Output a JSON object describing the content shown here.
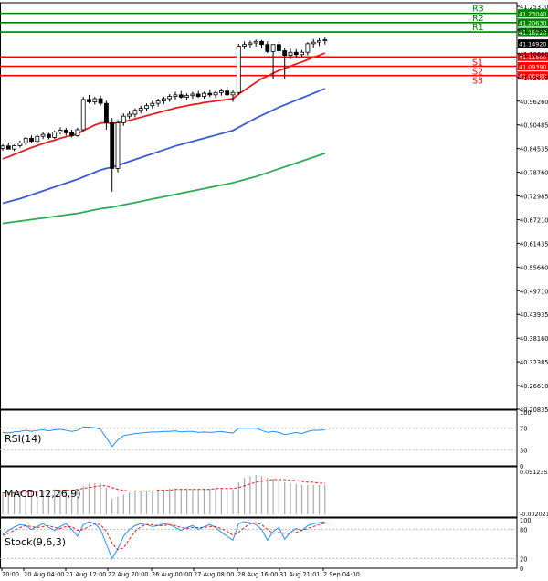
{
  "chart_data": [
    {
      "type": "candlestick",
      "panel": "price",
      "ylim": [
        40.20835,
        41.2531
      ],
      "y_ticks": [
        "41.25310",
        "41.17985",
        "41.10660",
        "41.02610",
        "40.96260",
        "40.90485",
        "40.84535",
        "40.78760",
        "40.72985",
        "40.67210",
        "40.61435",
        "40.55660",
        "40.49710",
        "40.43935",
        "40.38160",
        "40.32385",
        "40.26610",
        "40.20835"
      ],
      "x_ticks": [
        "20:00",
        "20 Aug 04:00",
        "21 Aug 12:00",
        "22 Aug 20:00",
        "26 Aug 00:00",
        "27 Aug 08:00",
        "28 Aug 16:00",
        "31 Aug 21:01",
        "2 Sep 04:00"
      ],
      "current_price": "41.14920",
      "levels": [
        {
          "name": "R3",
          "value": 41.2304,
          "label": "41.23040",
          "color": "#008000"
        },
        {
          "name": "R2",
          "value": 41.2063,
          "label": "41.20630",
          "color": "#008000"
        },
        {
          "name": "R1",
          "value": 41.1822,
          "label": "41.18220",
          "color": "#008000"
        },
        {
          "name": "S1",
          "value": 41.118,
          "label": "41.11800",
          "color": "#ff0000"
        },
        {
          "name": "S2",
          "value": 41.0939,
          "label": "41.09390",
          "color": "#ff0000"
        },
        {
          "name": "S3",
          "value": 41.0698,
          "label": "41.06980",
          "color": "#ff0000"
        }
      ],
      "candles": [
        [
          40.882,
          40.893,
          40.876,
          40.888
        ],
        [
          40.888,
          40.897,
          40.882,
          40.88
        ],
        [
          40.88,
          40.892,
          40.875,
          40.889
        ],
        [
          40.889,
          40.902,
          40.884,
          40.896
        ],
        [
          40.896,
          40.912,
          40.89,
          40.908
        ],
        [
          40.908,
          40.915,
          40.896,
          40.9
        ],
        [
          40.9,
          40.918,
          40.895,
          40.913
        ],
        [
          40.913,
          40.925,
          40.906,
          40.918
        ],
        [
          40.918,
          40.922,
          40.905,
          40.91
        ],
        [
          40.91,
          40.928,
          40.906,
          40.924
        ],
        [
          40.924,
          40.936,
          40.918,
          40.929
        ],
        [
          40.929,
          40.935,
          40.915,
          40.922
        ],
        [
          40.922,
          40.93,
          40.91,
          40.915
        ],
        [
          40.915,
          40.935,
          40.912,
          40.93
        ],
        [
          40.93,
          41.015,
          40.926,
          41.008
        ],
        [
          41.008,
          41.02,
          40.998,
          41.002
        ],
        [
          41.002,
          41.015,
          40.995,
          41.01
        ],
        [
          41.01,
          41.018,
          40.992,
          40.998
        ],
        [
          40.998,
          41.005,
          40.93,
          40.948
        ],
        [
          40.948,
          40.96,
          40.77,
          40.83
        ],
        [
          40.83,
          40.955,
          40.82,
          40.948
        ],
        [
          40.948,
          40.972,
          40.94,
          40.965
        ],
        [
          40.965,
          40.978,
          40.958,
          40.97
        ],
        [
          40.97,
          40.985,
          40.962,
          40.98
        ],
        [
          40.98,
          40.992,
          40.972,
          40.985
        ],
        [
          40.985,
          40.998,
          40.978,
          40.992
        ],
        [
          40.992,
          41.005,
          40.985,
          40.998
        ],
        [
          40.998,
          41.01,
          40.99,
          41.004
        ],
        [
          41.004,
          41.015,
          40.996,
          41.01
        ],
        [
          41.01,
          41.022,
          41.002,
          41.016
        ],
        [
          41.016,
          41.028,
          41.008,
          41.02
        ],
        [
          41.02,
          41.03,
          41.01,
          41.014
        ],
        [
          41.014,
          41.024,
          41.006,
          41.018
        ],
        [
          41.018,
          41.028,
          41.01,
          41.022
        ],
        [
          41.022,
          41.03,
          41.012,
          41.016
        ],
        [
          41.016,
          41.028,
          41.01,
          41.024
        ],
        [
          41.024,
          41.034,
          41.014,
          41.02
        ],
        [
          41.02,
          41.03,
          41.012,
          41.026
        ],
        [
          41.026,
          41.036,
          41.018,
          41.03
        ],
        [
          41.03,
          41.04,
          41.018,
          41.02
        ],
        [
          41.02,
          41.032,
          41.002,
          41.026
        ],
        [
          41.026,
          41.152,
          41.02,
          41.146
        ],
        [
          41.146,
          41.158,
          41.138,
          41.15
        ],
        [
          41.15,
          41.16,
          41.142,
          41.154
        ],
        [
          41.154,
          41.163,
          41.145,
          41.158
        ],
        [
          41.158,
          41.162,
          41.14,
          41.15
        ],
        [
          41.15,
          41.158,
          41.128,
          41.132
        ],
        [
          41.132,
          41.148,
          41.06,
          41.15
        ],
        [
          41.15,
          41.158,
          41.128,
          41.134
        ],
        [
          41.134,
          41.142,
          41.06,
          41.122
        ],
        [
          41.122,
          41.14,
          41.112,
          41.13
        ],
        [
          41.13,
          41.138,
          41.118,
          41.124
        ],
        [
          41.124,
          41.136,
          41.116,
          41.13
        ],
        [
          41.13,
          41.156,
          41.122,
          41.152
        ],
        [
          41.152,
          41.164,
          41.142,
          41.156
        ],
        [
          41.156,
          41.166,
          41.146,
          41.16
        ],
        [
          41.16,
          41.168,
          41.15,
          41.162
        ]
      ],
      "sma_short": [
        40.855,
        40.86,
        40.866,
        40.872,
        40.878,
        40.884,
        40.889,
        40.894,
        40.899,
        40.903,
        40.908,
        40.912,
        40.915,
        40.919,
        40.928,
        40.935,
        40.942,
        40.947,
        40.948,
        40.946,
        40.948,
        40.951,
        40.954,
        40.958,
        40.962,
        40.966,
        40.97,
        40.974,
        40.978,
        40.982,
        40.986,
        40.989,
        40.992,
        40.995,
        40.997,
        41.0,
        41.002,
        41.004,
        41.006,
        41.008,
        41.01,
        41.022,
        41.032,
        41.042,
        41.052,
        41.062,
        41.068,
        41.076,
        41.083,
        41.088,
        41.094,
        41.1,
        41.105,
        41.111,
        41.117,
        41.122,
        41.128
      ],
      "sma_mid": [
        40.74,
        40.744,
        40.748,
        40.752,
        40.757,
        40.762,
        40.767,
        40.772,
        40.777,
        40.782,
        40.787,
        40.792,
        40.797,
        40.802,
        40.808,
        40.814,
        40.82,
        40.826,
        40.83,
        40.833,
        40.838,
        40.843,
        40.848,
        40.853,
        40.858,
        40.863,
        40.868,
        40.873,
        40.878,
        40.883,
        40.888,
        40.892,
        40.896,
        40.9,
        40.904,
        40.908,
        40.912,
        40.916,
        40.92,
        40.924,
        40.928,
        40.936,
        40.944,
        40.952,
        40.96,
        40.967,
        40.974,
        40.981,
        40.988,
        40.994,
        41.0,
        41.006,
        41.012,
        41.018,
        41.024,
        41.03,
        41.036
      ],
      "sma_long": [
        40.688,
        40.69,
        40.692,
        40.694,
        40.696,
        40.698,
        40.7,
        40.702,
        40.704,
        40.706,
        40.708,
        40.71,
        40.712,
        40.714,
        40.717,
        40.72,
        40.723,
        40.726,
        40.728,
        40.73,
        40.733,
        40.736,
        40.739,
        40.742,
        40.745,
        40.748,
        40.751,
        40.754,
        40.757,
        40.76,
        40.763,
        40.766,
        40.769,
        40.772,
        40.775,
        40.778,
        40.781,
        40.784,
        40.787,
        40.79,
        40.793,
        40.797,
        40.801,
        40.805,
        40.809,
        40.814,
        40.819,
        40.824,
        40.829,
        40.834,
        40.839,
        40.844,
        40.849,
        40.854,
        40.859,
        40.864,
        40.869
      ]
    },
    {
      "type": "line",
      "panel": "rsi",
      "label": "RSI(14)",
      "ylim": [
        0,
        100
      ],
      "y_ticks": [
        "100",
        "70",
        "30",
        "0"
      ],
      "values": [
        62,
        61,
        63,
        64,
        66,
        64,
        66,
        67,
        65,
        67,
        68,
        66,
        64,
        66,
        72,
        72,
        71,
        68,
        52,
        36,
        48,
        56,
        58,
        60,
        61,
        62,
        63,
        63,
        64,
        64,
        65,
        63,
        64,
        64,
        62,
        63,
        62,
        63,
        64,
        62,
        61,
        70,
        70,
        70,
        70,
        66,
        62,
        64,
        62,
        58,
        60,
        62,
        60,
        64,
        66,
        66,
        67
      ]
    },
    {
      "type": "histogram+line",
      "panel": "macd",
      "label": "MACD(12,26,9)",
      "ylim": [
        -0.003,
        0.051235
      ],
      "y_ticks": [
        "0.051235",
        "-0.002021"
      ],
      "histogram": [
        0.024,
        0.024,
        0.025,
        0.025,
        0.026,
        0.026,
        0.027,
        0.027,
        0.027,
        0.028,
        0.028,
        0.028,
        0.028,
        0.028,
        0.032,
        0.034,
        0.035,
        0.035,
        0.03,
        0.018,
        0.02,
        0.022,
        0.024,
        0.025,
        0.026,
        0.027,
        0.027,
        0.028,
        0.028,
        0.029,
        0.029,
        0.029,
        0.029,
        0.029,
        0.029,
        0.029,
        0.029,
        0.029,
        0.029,
        0.029,
        0.028,
        0.036,
        0.041,
        0.043,
        0.044,
        0.043,
        0.041,
        0.04,
        0.038,
        0.036,
        0.035,
        0.034,
        0.033,
        0.033,
        0.033,
        0.033,
        0.033
      ],
      "signal": [
        0.024,
        0.024,
        0.024,
        0.025,
        0.025,
        0.025,
        0.026,
        0.026,
        0.026,
        0.027,
        0.027,
        0.027,
        0.027,
        0.028,
        0.029,
        0.03,
        0.031,
        0.032,
        0.032,
        0.03,
        0.028,
        0.027,
        0.026,
        0.026,
        0.026,
        0.026,
        0.026,
        0.027,
        0.027,
        0.027,
        0.028,
        0.028,
        0.028,
        0.028,
        0.028,
        0.028,
        0.028,
        0.029,
        0.029,
        0.029,
        0.029,
        0.03,
        0.032,
        0.034,
        0.036,
        0.037,
        0.038,
        0.039,
        0.039,
        0.039,
        0.038,
        0.038,
        0.037,
        0.036,
        0.036,
        0.035,
        0.035
      ]
    },
    {
      "type": "line",
      "panel": "stoch",
      "label": "Stock(9,6,3)",
      "ylim": [
        0,
        100
      ],
      "y_ticks": [
        "100",
        "80",
        "20",
        "0"
      ],
      "main": [
        70,
        78,
        85,
        90,
        88,
        80,
        86,
        92,
        84,
        78,
        86,
        92,
        80,
        66,
        90,
        96,
        92,
        80,
        50,
        20,
        40,
        66,
        80,
        88,
        92,
        90,
        86,
        88,
        92,
        90,
        84,
        78,
        84,
        88,
        80,
        86,
        90,
        84,
        74,
        66,
        58,
        92,
        96,
        94,
        90,
        80,
        58,
        76,
        84,
        60,
        74,
        82,
        78,
        88,
        92,
        94,
        96
      ],
      "signal": [
        68,
        72,
        78,
        84,
        88,
        86,
        84,
        86,
        88,
        84,
        82,
        86,
        86,
        78,
        80,
        86,
        92,
        90,
        76,
        52,
        38,
        42,
        60,
        76,
        86,
        90,
        90,
        88,
        88,
        90,
        88,
        84,
        82,
        84,
        84,
        84,
        86,
        86,
        82,
        76,
        68,
        74,
        84,
        92,
        94,
        90,
        80,
        72,
        74,
        72,
        72,
        74,
        78,
        82,
        86,
        90,
        93
      ]
    }
  ]
}
